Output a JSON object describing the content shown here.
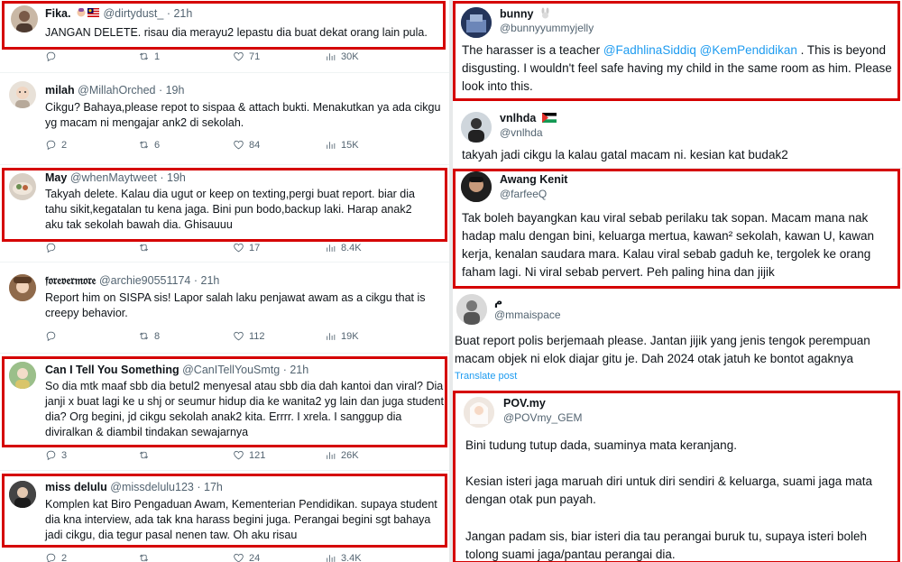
{
  "left": {
    "t1": {
      "name": "Fika.",
      "handle": "@dirtydust_",
      "time": "· 21h",
      "text": "JANGAN DELETE. risau dia merayu2 lepastu dia buat dekat orang lain pula.",
      "retweets": "1",
      "likes": "71",
      "views": "30K"
    },
    "t2": {
      "name": "milah",
      "handle": "@MillahOrched",
      "time": "· 19h",
      "text": "Cikgu? Bahaya,please repot to sispaa & attach bukti. Menakutkan ya ada cikgu yg macam ni mengajar ank2 di sekolah.",
      "replies": "2",
      "retweets": "6",
      "likes": "84",
      "views": "15K"
    },
    "t3": {
      "name": "May",
      "handle": "@whenMaytweet",
      "time": "· 19h",
      "text": "Takyah delete. Kalau dia ugut or keep on texting,pergi buat report. biar dia tahu sikit,kegatalan tu kena jaga. Bini pun bodo,backup laki. Harap anak2 aku tak sekolah bawah dia. Ghisauuu",
      "likes": "17",
      "views": "8.4K"
    },
    "t4": {
      "name": "𝔣𝔬𝔯𝔢𝔳𝔢𝔯𝔪𝔬𝔯𝔢",
      "handle": "@archie90551174",
      "time": "· 21h",
      "text": "Report him on SISPA sis! Lapor salah laku penjawat awam as a cikgu that is creepy behavior.",
      "retweets": "8",
      "likes": "112",
      "views": "19K"
    },
    "t5": {
      "name": "Can I Tell You Something",
      "handle": "@CanITellYouSmtg",
      "time": "· 21h",
      "text": "So dia mtk maaf sbb dia betul2 menyesal atau sbb dia dah kantoi dan viral? Dia janji x buat lagi ke u shj or seumur hidup dia ke wanita2 yg lain dan juga student dia? Org begini, jd cikgu sekolah anak2 kita. Errrr. I xrela. I sanggup dia diviralkan & diambil tindakan sewajarnya",
      "replies": "3",
      "likes": "121",
      "views": "26K"
    },
    "t6": {
      "name": "miss delulu",
      "handle": "@missdelulu123",
      "time": "· 17h",
      "text": "Komplen kat Biro Pengaduan Awam, Kementerian Pendidikan. supaya student dia kna interview, ada tak kna harass begini juga. Perangai begini sgt bahaya jadi cikgu, dia tegur pasal nenen taw. Oh aku risau",
      "replies": "2",
      "likes": "24",
      "views": "3.4K"
    }
  },
  "right": {
    "r1": {
      "name": "bunny",
      "handle": "@bunnyyummyjelly",
      "text_pre": "The harasser is a teacher ",
      "mention1": "@FadhlinaSiddiq",
      "mention2": "@KemPendidikan",
      "text_post": ". This is beyond disgusting. I wouldn't feel safe having my child in the same room as him. Please look into this."
    },
    "r2": {
      "name": "vnlhda",
      "handle": "@vnlhda",
      "text": "takyah jadi cikgu la kalau gatal macam ni. kesian kat budak2"
    },
    "r3": {
      "name": "Awang Kenit",
      "handle": "@farfeeQ",
      "text": "Tak boleh bayangkan kau viral sebab perilaku tak sopan. Macam mana nak hadap malu dengan bini, keluarga mertua, kawan² sekolah, kawan U, kawan kerja, kenalan saudara mara. Kalau viral sebab gaduh ke, tergolek ke orang faham lagi. Ni viral sebab pervert. Peh paling hina dan jijik"
    },
    "r4": {
      "name": "م",
      "handle": "@mmaispace",
      "text": "Buat report polis berjemaah please. Jantan jijik yang jenis tengok perempuan macam objek ni elok diajar gitu je. Dah 2024 otak jatuh ke bontot agaknya",
      "translate": "Translate post"
    },
    "r5": {
      "name": "POV.my",
      "handle": "@POVmy_GEM",
      "p1": "Bini tudung tutup dada, suaminya mata keranjang.",
      "p2": "Kesian isteri jaga maruah diri untuk diri sendiri & keluarga, suami jaga mata dengan otak pun payah.",
      "p3": "Jangan padam sis, biar isteri dia tau perangai buruk tu, supaya isteri boleh tolong suami jaga/pantau perangai dia."
    }
  },
  "colors": {
    "highlight": "#d50000",
    "link": "#1d9bf0",
    "muted": "#536471"
  }
}
